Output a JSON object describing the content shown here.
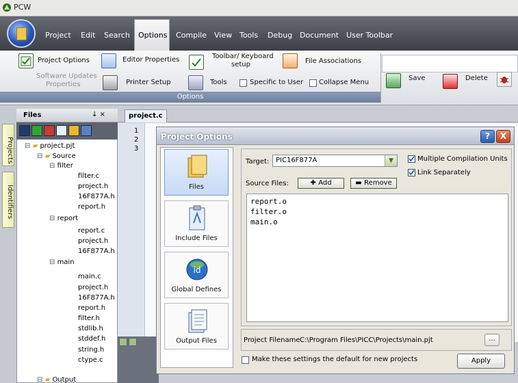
{
  "window": {
    "title": "PCW"
  },
  "menu": [
    "Project",
    "Edit",
    "Search",
    "Options",
    "Compile",
    "View",
    "Tools",
    "Debug",
    "Document",
    "User Toolbar"
  ],
  "ribbon": {
    "project_options": "Project Options",
    "editor_properties": "Editor Properties",
    "toolbar_keyboard_setup_1": "Toolbar/ Keyboard",
    "toolbar_keyboard_setup_2": "setup",
    "file_associations": "File Associations",
    "software_updates_1": "Software Updates",
    "software_updates_2": "Properties",
    "printer_setup": "Printer Setup",
    "tools": "Tools",
    "specific_to_user": "Specific to User",
    "collapse_menu": "Collapse Menu",
    "group_label": "Options",
    "save": "Save",
    "delete": "Delete"
  },
  "side_tabs": {
    "projects": "Projects",
    "identifiers": "Identifiers"
  },
  "files_panel": {
    "title": "Files",
    "pin": "↓ ×",
    "tree": [
      {
        "label": "project.pjt",
        "depth": 0
      },
      {
        "label": "Source",
        "depth": 1
      },
      {
        "label": "filter",
        "depth": 2
      },
      {
        "label": "filter.c",
        "depth": 3
      },
      {
        "label": "project.h",
        "depth": 3
      },
      {
        "label": "16F877A.h",
        "depth": 3
      },
      {
        "label": "report.h",
        "depth": 3
      },
      {
        "label": "report",
        "depth": 2
      },
      {
        "label": "report.c",
        "depth": 3
      },
      {
        "label": "project.h",
        "depth": 3
      },
      {
        "label": "16F877A.h",
        "depth": 3
      },
      {
        "label": "main",
        "depth": 2
      },
      {
        "label": "main.c",
        "depth": 3
      },
      {
        "label": "project.h",
        "depth": 3
      },
      {
        "label": "16F877A.h",
        "depth": 3
      },
      {
        "label": "report.h",
        "depth": 3
      },
      {
        "label": "filter.h",
        "depth": 3
      },
      {
        "label": "stdlib.h",
        "depth": 3
      },
      {
        "label": "stddef.h",
        "depth": 3
      },
      {
        "label": "string.h",
        "depth": 3
      },
      {
        "label": "ctype.c",
        "depth": 3
      },
      {
        "label": "Output",
        "depth": 1
      }
    ]
  },
  "editor": {
    "tab": "project.c",
    "line_numbers": [
      "1",
      "2",
      "3"
    ]
  },
  "dialog": {
    "title": "Project Options",
    "help": "?",
    "close": "X",
    "categories": [
      "Files",
      "Include Files",
      "Global Defines",
      "Output Files"
    ],
    "target_label": "Target:",
    "target_value": "PIC16F877A",
    "multiple_compilation_units": "Multiple Compilation Units",
    "link_separately": "Link Separately",
    "source_files_label": "Source Files:",
    "add_button": "Add",
    "remove_button": "Remove",
    "source_files": [
      "report.o",
      "filter.o",
      "main.o"
    ],
    "project_filename_label": "Project Filename",
    "project_filename_value": "C:\\Program Files\\PICC\\Projects\\main.pjt",
    "browse_button": "...",
    "default_checkbox": "Make these settings the default for new projects",
    "apply_button": "Apply"
  }
}
